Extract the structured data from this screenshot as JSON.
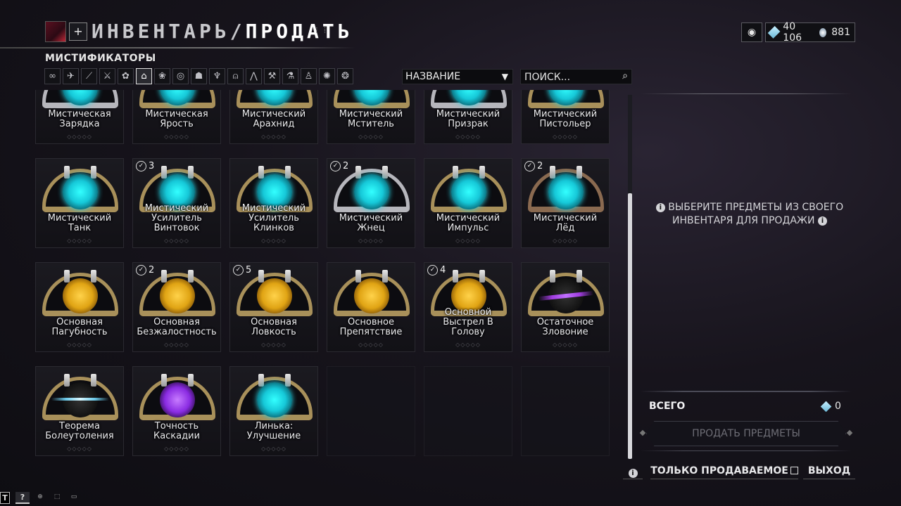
{
  "header": {
    "title_part1": "ИНВЕНТАРЬ/",
    "title_part2": "ПРОДАТЬ",
    "add_label": "+",
    "platinum": "40 106",
    "credits": "881"
  },
  "category": "МИСТИФИКАТОРЫ",
  "filter_icons": [
    "infinity-icon",
    "warframe-icon",
    "primary-icon",
    "secondary-icon",
    "melee-icon",
    "mods-icon",
    "relic-icon",
    "arcane-icon",
    "companion-icon",
    "archwing-icon",
    "sentinel-icon",
    "amp-icon",
    "zaw-icon",
    "kitgun-icon",
    "lens-icon",
    "resource-icon",
    "misc-icon"
  ],
  "filter_glyphs": [
    "∞",
    "✈",
    "⟋",
    "⚔",
    "✿",
    "⌂",
    "❀",
    "◎",
    "☗",
    "♆",
    "⍝",
    "⋀",
    "⚒",
    "⚗",
    "♙",
    "✺",
    "❂"
  ],
  "sort": {
    "label": "НАЗВАНИЕ",
    "arrow": "▼"
  },
  "search": {
    "placeholder": "ПОИСК...",
    "icon": "🔍"
  },
  "tiles": [
    {
      "name": "Мистическая Зарядка",
      "count": "",
      "theme": "cyan",
      "frame": "silver"
    },
    {
      "name": "Мистическая Ярость",
      "count": "",
      "theme": "cyan",
      "frame": "gold"
    },
    {
      "name": "Мистический Арахнид",
      "count": "",
      "theme": "cyan",
      "frame": "gold"
    },
    {
      "name": "Мистический Мститель",
      "count": "",
      "theme": "cyan",
      "frame": "gold"
    },
    {
      "name": "Мистический Призрак",
      "count": "",
      "theme": "cyan",
      "frame": "silver"
    },
    {
      "name": "Мистический Пистольер",
      "count": "",
      "theme": "cyan",
      "frame": "gold"
    },
    {
      "name": "Мистический Танк",
      "count": "",
      "theme": "cyan",
      "frame": "gold"
    },
    {
      "name": "Мистический Усилитель Винтовок",
      "count": "3",
      "theme": "cyan",
      "frame": "gold"
    },
    {
      "name": "Мистический Усилитель Клинков",
      "count": "",
      "theme": "cyan",
      "frame": "gold"
    },
    {
      "name": "Мистический Жнец",
      "count": "2",
      "theme": "cyan",
      "frame": "silver"
    },
    {
      "name": "Мистический Импульс",
      "count": "",
      "theme": "cyan",
      "frame": "gold"
    },
    {
      "name": "Мистический Лёд",
      "count": "2",
      "theme": "cyan",
      "frame": "bronze"
    },
    {
      "name": "Основная Пагубность",
      "count": "",
      "theme": "gold",
      "frame": "gold"
    },
    {
      "name": "Основная Безжалостность",
      "count": "2",
      "theme": "gold",
      "frame": "gold"
    },
    {
      "name": "Основная Ловкость",
      "count": "5",
      "theme": "gold",
      "frame": "gold"
    },
    {
      "name": "Основное Препятствие",
      "count": "",
      "theme": "gold",
      "frame": "gold"
    },
    {
      "name": "Основной Выстрел В Голову",
      "count": "4",
      "theme": "gold",
      "frame": "gold"
    },
    {
      "name": "Остаточное Зловоние",
      "count": "",
      "theme": "dark-purple",
      "frame": "gold"
    },
    {
      "name": "Теорема Болеутоления",
      "count": "",
      "theme": "dark-blue",
      "frame": "gold"
    },
    {
      "name": "Точность Каскадии",
      "count": "",
      "theme": "violet",
      "frame": "gold"
    },
    {
      "name": "Линька: Улучшение",
      "count": "",
      "theme": "cyan",
      "frame": "gold"
    },
    {
      "name": "",
      "count": "",
      "theme": "empty",
      "frame": ""
    },
    {
      "name": "",
      "count": "",
      "theme": "empty",
      "frame": ""
    },
    {
      "name": "",
      "count": "",
      "theme": "empty",
      "frame": ""
    }
  ],
  "rank_pips": "◇◇◇◇◇",
  "right_panel": {
    "message_line1": "ВЫБЕРИТЕ ПРЕДМЕТЫ ИЗ СВОЕГО",
    "message_line2": "ИНВЕНТАРЯ ДЛЯ ПРОДАЖИ",
    "total_label": "ВСЕГО",
    "total_value": "0",
    "sell_button": "ПРОДАТЬ ПРЕДМЕТЫ"
  },
  "footer": {
    "only_sellable": "ТОЛЬКО ПРОДАВАЕМОЕ",
    "exit": "ВЫХОД"
  },
  "bottom_bar": {
    "t_key": "T",
    "help_key": "?"
  },
  "colors": {
    "accent_cyan": "#16c8d8",
    "accent_gold": "#e0a414",
    "frame_gold": "#a8905a"
  }
}
